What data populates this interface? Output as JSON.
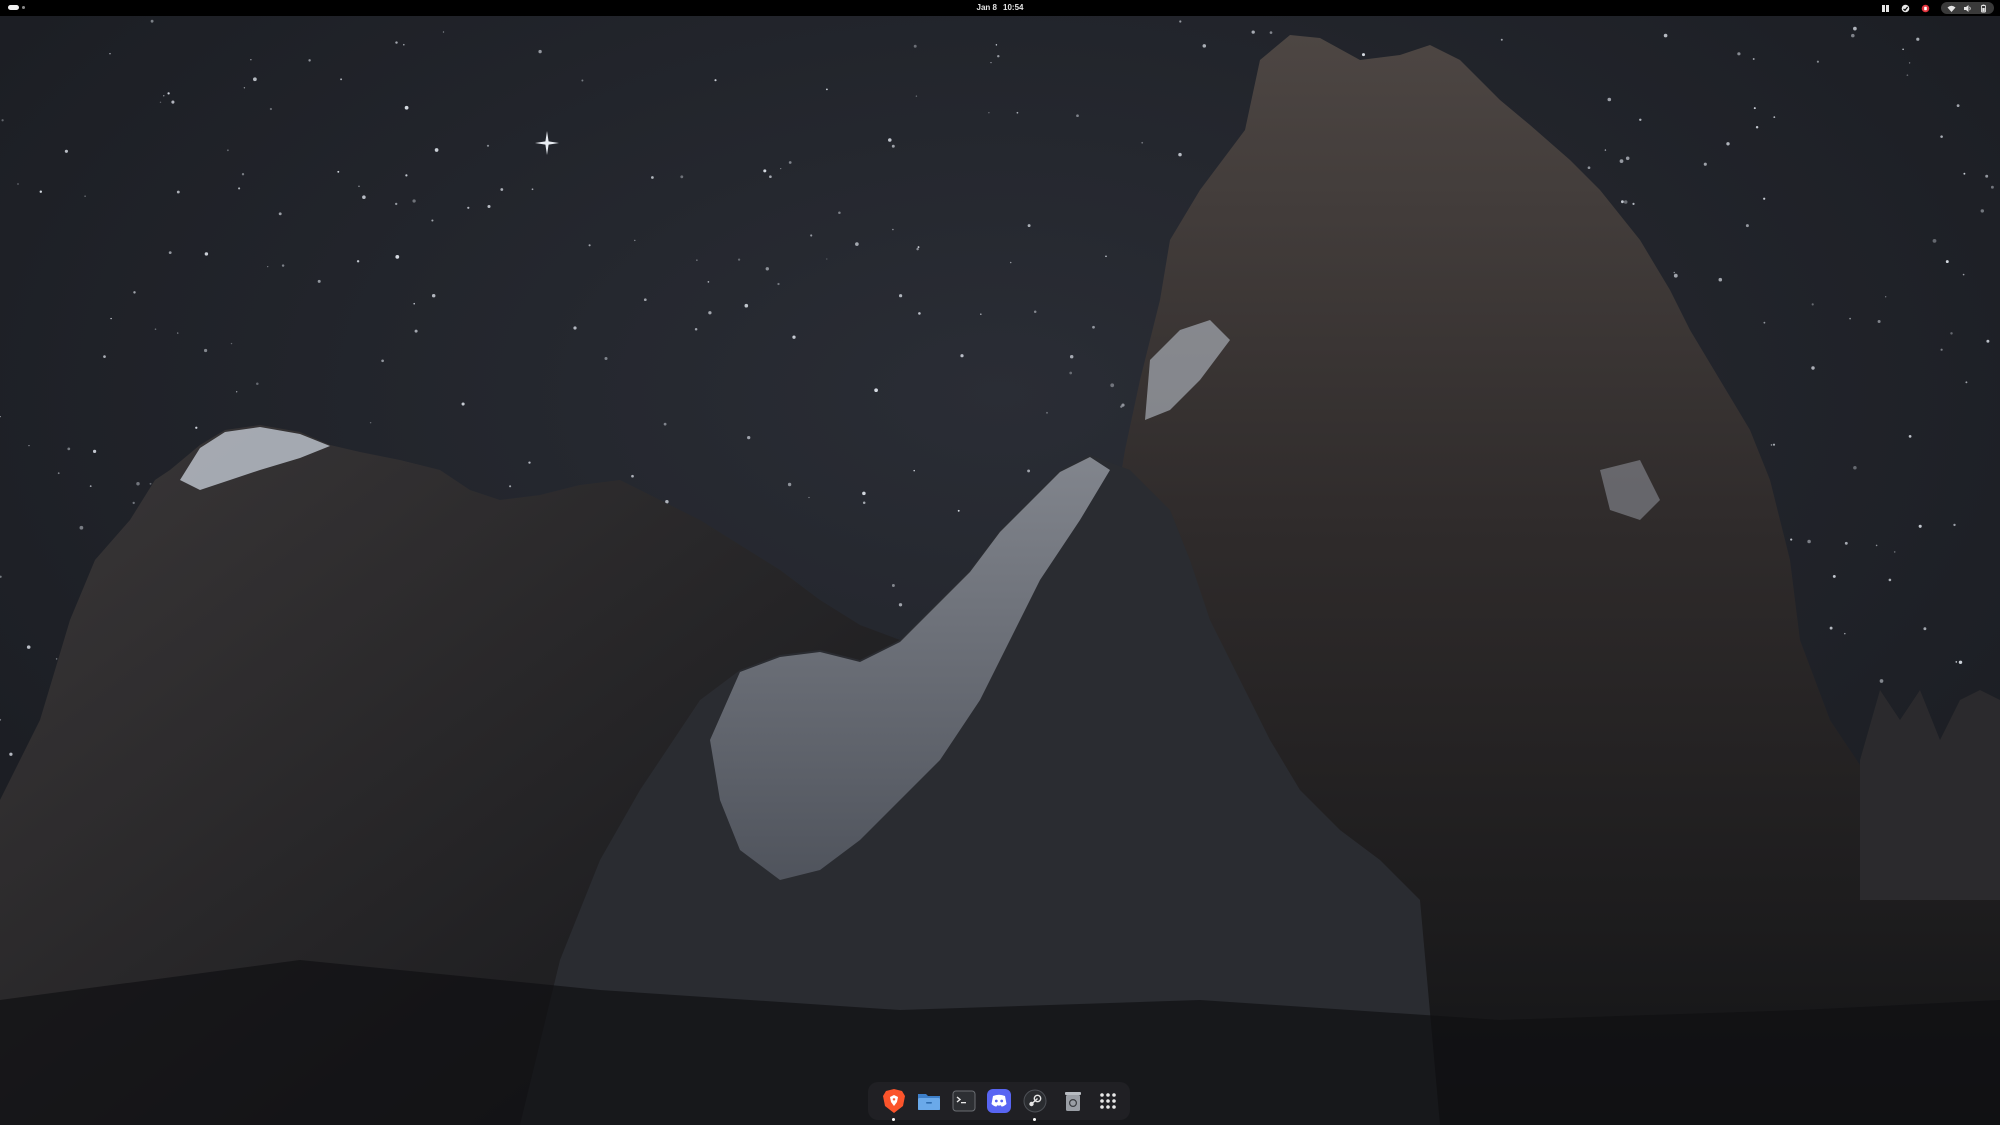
{
  "topbar": {
    "date": "Jan 8",
    "time": "10:54"
  },
  "colors": {
    "topbar_bg": "#000000",
    "sky": "#22252c",
    "brave": "#fb542b",
    "files": "#5e9fe0",
    "discord": "#5865f2",
    "status_alert": "#e0323c"
  },
  "tray_icons": [
    "window-list-icon",
    "sync-icon",
    "notification-alert-icon",
    "network-icon",
    "volume-icon",
    "battery-icon"
  ],
  "dock": {
    "items": [
      {
        "name": "brave-browser-icon",
        "running": true
      },
      {
        "name": "files-icon",
        "running": false
      },
      {
        "name": "terminal-icon",
        "running": false
      },
      {
        "name": "discord-icon",
        "running": false
      },
      {
        "name": "steam-icon",
        "running": true
      },
      {
        "name": "trash-icon",
        "running": false
      },
      {
        "name": "app-grid-icon",
        "running": false
      }
    ]
  }
}
